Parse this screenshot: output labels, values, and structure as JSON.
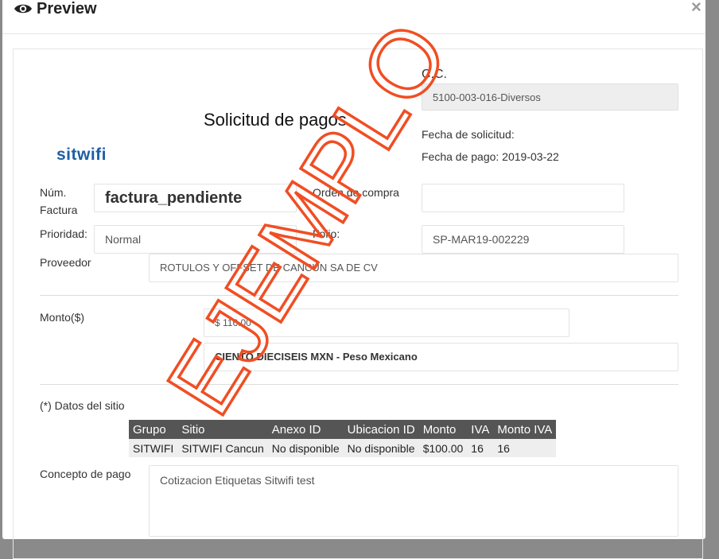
{
  "modal": {
    "title": "Preview",
    "close_label": "×"
  },
  "form": {
    "cc_label": "C.C.",
    "cc_value": "5100-003-016-Diversos",
    "heading": "Solicitud de pagos",
    "logo_text": "sitwifi",
    "fecha_solicitud_label": "Fecha de solicitud:",
    "fecha_pago_text": "Fecha de pago: 2019-03-22",
    "num_factura_label": "Núm. Factura",
    "num_factura_value": "factura_pendiente",
    "orden_compra_label": "Orden de compra",
    "orden_compra_value": "",
    "prioridad_label": "Prioridad:",
    "prioridad_value": "Normal",
    "folio_label": "Folio:",
    "folio_value": "SP-MAR19-002229",
    "proveedor_label": "Proveedor",
    "proveedor_value": "ROTULOS Y OFFSET DE CANCUN SA DE CV",
    "monto_label": "Monto($)",
    "monto_value": "$ 116.00",
    "monto_letra": "CIENTO DIECISEIS MXN - Peso Mexicano",
    "datos_sitio_label": "(*) Datos del sitio",
    "concepto_label": "Concepto de pago",
    "concepto_value": "Cotizacion Etiquetas Sitwifi test"
  },
  "sites_table": {
    "headers": [
      "Grupo",
      "Sitio",
      "Anexo ID",
      "Ubicacion ID",
      "Monto",
      "IVA",
      "Monto IVA"
    ],
    "rows": [
      [
        "SITWIFI",
        "SITWIFI Cancun",
        "No disponible",
        "No disponible",
        "$100.00",
        "16",
        "16"
      ]
    ]
  },
  "watermark": {
    "text": "EJEMPLO",
    "color": "#f04e23"
  },
  "colors": {
    "header_bg": "#555555",
    "field_bg": "#eeeeee",
    "logo": "#1d5fa3"
  }
}
